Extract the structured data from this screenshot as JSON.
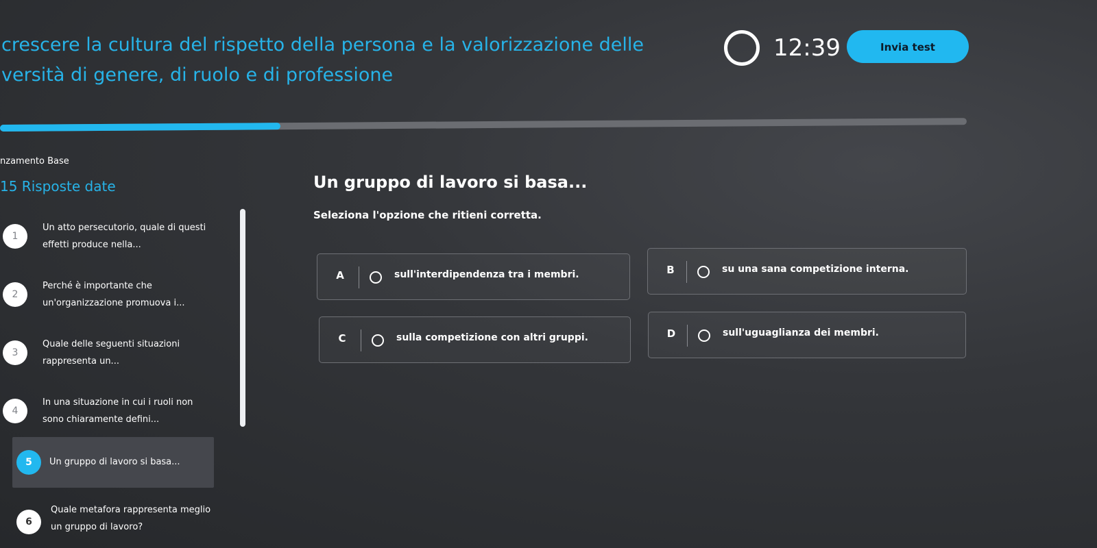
{
  "header": {
    "course_title": "crescere la cultura del rispetto della persona e la valorizzazione delle\nversità di genere, di ruolo e di professione",
    "timer": "12:39",
    "submit_label": "Invia test"
  },
  "progress": {
    "fraction": 0.29
  },
  "sidebar": {
    "level_label": "nzamento Base",
    "answers_count": "15 Risposte date",
    "questions": [
      {
        "number": "1",
        "text": "Un atto persecutorio, quale di questi effetti produce nella..."
      },
      {
        "number": "2",
        "text": "Perché è importante che un'organizzazione promuova i..."
      },
      {
        "number": "3",
        "text": "Quale delle seguenti situazioni rappresenta un..."
      },
      {
        "number": "4",
        "text": "In una situazione in cui i ruoli non sono chiaramente defini..."
      },
      {
        "number": "5",
        "text": "Un gruppo di lavoro si basa..."
      },
      {
        "number": "6",
        "text": "Quale metafora rappresenta meglio un gruppo di lavoro?"
      }
    ]
  },
  "main": {
    "question_title": "Un gruppo di lavoro si basa...",
    "instructions": "Seleziona l'opzione che ritieni corretta.",
    "options": [
      {
        "letter": "A",
        "text": "sull'interdipendenza tra i membri."
      },
      {
        "letter": "B",
        "text": "su una sana competizione interna."
      },
      {
        "letter": "C",
        "text": "sulla competizione con altri gruppi."
      },
      {
        "letter": "D",
        "text": "sull'uguaglianza dei membri."
      }
    ]
  },
  "colors": {
    "accent": "#22b8ef",
    "background": "#2a2c30"
  }
}
